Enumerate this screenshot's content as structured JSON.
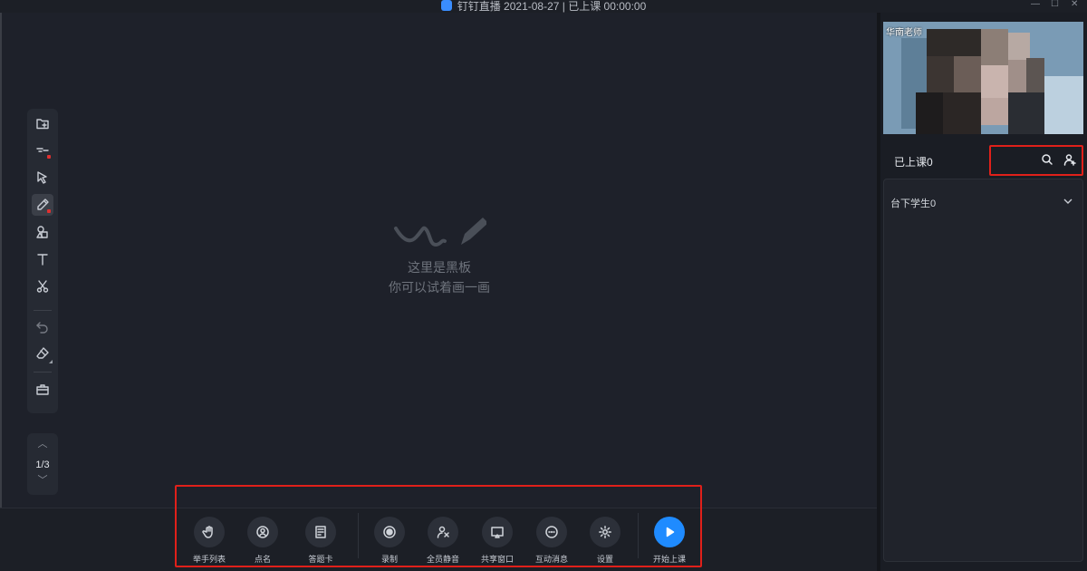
{
  "window": {
    "title": "钉钉直播 2021-08-27 | 已上课 00:00:00",
    "minimize_glyph": "—",
    "maximize_glyph": "☐",
    "close_glyph": "✕"
  },
  "toolbar": {
    "tools": [
      {
        "icon": "add-page-icon"
      },
      {
        "icon": "laser-pointer-icon"
      },
      {
        "icon": "select-cursor-icon"
      },
      {
        "icon": "pen-icon",
        "active": true
      },
      {
        "icon": "shapes-icon"
      },
      {
        "icon": "text-icon"
      },
      {
        "icon": "scissors-icon"
      },
      {
        "icon": "undo-icon"
      },
      {
        "icon": "eraser-icon"
      },
      {
        "icon": "toolbox-icon"
      }
    ]
  },
  "pager": {
    "current": "1/3"
  },
  "board_hint": {
    "line1": "这里是黑板",
    "line2": "你可以试着画一画"
  },
  "controls": {
    "raise_hand": "举手列表",
    "roll_call": "点名",
    "answer_card": "答题卡",
    "record": "录制",
    "mute_all": "全员静音",
    "share_window": "共享窗口",
    "interactive_messages": "互动消息",
    "settings": "设置",
    "start_class": "开始上课"
  },
  "right_panel": {
    "teacher_name": "华南老师",
    "attended_label": "已上课0",
    "offstage_label": "台下学生0"
  },
  "colors": {
    "accent": "#1f8bff",
    "highlight_box": "#e0201a",
    "background": "#1e212a"
  }
}
